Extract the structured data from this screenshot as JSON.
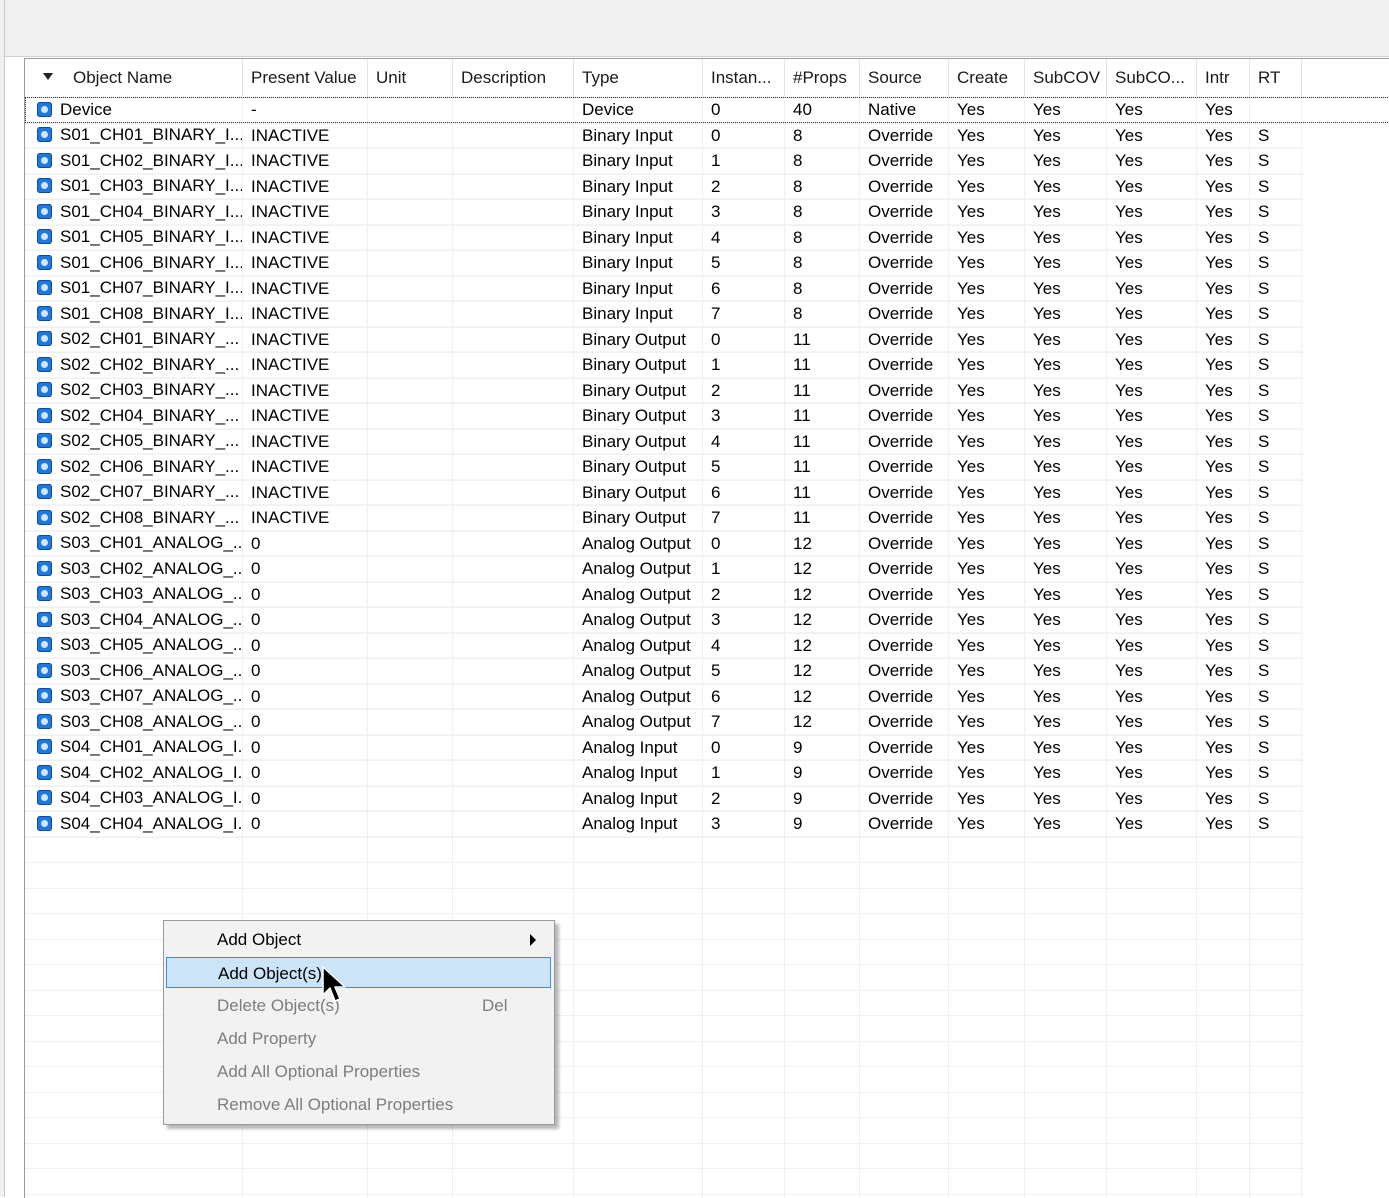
{
  "columns": [
    {
      "key": "name",
      "label": "Object Name"
    },
    {
      "key": "pv",
      "label": "Present Value"
    },
    {
      "key": "unit",
      "label": "Unit"
    },
    {
      "key": "desc",
      "label": "Description"
    },
    {
      "key": "type",
      "label": "Type"
    },
    {
      "key": "inst",
      "label": "Instan..."
    },
    {
      "key": "props",
      "label": "#Props"
    },
    {
      "key": "source",
      "label": "Source"
    },
    {
      "key": "create",
      "label": "Create"
    },
    {
      "key": "subcov",
      "label": "SubCOV"
    },
    {
      "key": "subco",
      "label": "SubCO..."
    },
    {
      "key": "intr",
      "label": "Intr"
    },
    {
      "key": "rt",
      "label": "RT"
    }
  ],
  "rows": [
    {
      "name": "Device",
      "pv": "-",
      "unit": "",
      "desc": "",
      "type": "Device",
      "inst": "0",
      "props": "40",
      "source": "Native",
      "create": "Yes",
      "subcov": "Yes",
      "subco": "Yes",
      "intr": "Yes",
      "rt": ""
    },
    {
      "name": "S01_CH01_BINARY_I...",
      "pv": "INACTIVE",
      "unit": "",
      "desc": "",
      "type": "Binary Input",
      "inst": "0",
      "props": "8",
      "source": "Override",
      "create": "Yes",
      "subcov": "Yes",
      "subco": "Yes",
      "intr": "Yes",
      "rt": "S"
    },
    {
      "name": "S01_CH02_BINARY_I...",
      "pv": "INACTIVE",
      "unit": "",
      "desc": "",
      "type": "Binary Input",
      "inst": "1",
      "props": "8",
      "source": "Override",
      "create": "Yes",
      "subcov": "Yes",
      "subco": "Yes",
      "intr": "Yes",
      "rt": "S"
    },
    {
      "name": "S01_CH03_BINARY_I...",
      "pv": "INACTIVE",
      "unit": "",
      "desc": "",
      "type": "Binary Input",
      "inst": "2",
      "props": "8",
      "source": "Override",
      "create": "Yes",
      "subcov": "Yes",
      "subco": "Yes",
      "intr": "Yes",
      "rt": "S"
    },
    {
      "name": "S01_CH04_BINARY_I...",
      "pv": "INACTIVE",
      "unit": "",
      "desc": "",
      "type": "Binary Input",
      "inst": "3",
      "props": "8",
      "source": "Override",
      "create": "Yes",
      "subcov": "Yes",
      "subco": "Yes",
      "intr": "Yes",
      "rt": "S"
    },
    {
      "name": "S01_CH05_BINARY_I...",
      "pv": "INACTIVE",
      "unit": "",
      "desc": "",
      "type": "Binary Input",
      "inst": "4",
      "props": "8",
      "source": "Override",
      "create": "Yes",
      "subcov": "Yes",
      "subco": "Yes",
      "intr": "Yes",
      "rt": "S"
    },
    {
      "name": "S01_CH06_BINARY_I...",
      "pv": "INACTIVE",
      "unit": "",
      "desc": "",
      "type": "Binary Input",
      "inst": "5",
      "props": "8",
      "source": "Override",
      "create": "Yes",
      "subcov": "Yes",
      "subco": "Yes",
      "intr": "Yes",
      "rt": "S"
    },
    {
      "name": "S01_CH07_BINARY_I...",
      "pv": "INACTIVE",
      "unit": "",
      "desc": "",
      "type": "Binary Input",
      "inst": "6",
      "props": "8",
      "source": "Override",
      "create": "Yes",
      "subcov": "Yes",
      "subco": "Yes",
      "intr": "Yes",
      "rt": "S"
    },
    {
      "name": "S01_CH08_BINARY_I...",
      "pv": "INACTIVE",
      "unit": "",
      "desc": "",
      "type": "Binary Input",
      "inst": "7",
      "props": "8",
      "source": "Override",
      "create": "Yes",
      "subcov": "Yes",
      "subco": "Yes",
      "intr": "Yes",
      "rt": "S"
    },
    {
      "name": "S02_CH01_BINARY_...",
      "pv": "INACTIVE",
      "unit": "",
      "desc": "",
      "type": "Binary Output",
      "inst": "0",
      "props": "11",
      "source": "Override",
      "create": "Yes",
      "subcov": "Yes",
      "subco": "Yes",
      "intr": "Yes",
      "rt": "S"
    },
    {
      "name": "S02_CH02_BINARY_...",
      "pv": "INACTIVE",
      "unit": "",
      "desc": "",
      "type": "Binary Output",
      "inst": "1",
      "props": "11",
      "source": "Override",
      "create": "Yes",
      "subcov": "Yes",
      "subco": "Yes",
      "intr": "Yes",
      "rt": "S"
    },
    {
      "name": "S02_CH03_BINARY_...",
      "pv": "INACTIVE",
      "unit": "",
      "desc": "",
      "type": "Binary Output",
      "inst": "2",
      "props": "11",
      "source": "Override",
      "create": "Yes",
      "subcov": "Yes",
      "subco": "Yes",
      "intr": "Yes",
      "rt": "S"
    },
    {
      "name": "S02_CH04_BINARY_...",
      "pv": "INACTIVE",
      "unit": "",
      "desc": "",
      "type": "Binary Output",
      "inst": "3",
      "props": "11",
      "source": "Override",
      "create": "Yes",
      "subcov": "Yes",
      "subco": "Yes",
      "intr": "Yes",
      "rt": "S"
    },
    {
      "name": "S02_CH05_BINARY_...",
      "pv": "INACTIVE",
      "unit": "",
      "desc": "",
      "type": "Binary Output",
      "inst": "4",
      "props": "11",
      "source": "Override",
      "create": "Yes",
      "subcov": "Yes",
      "subco": "Yes",
      "intr": "Yes",
      "rt": "S"
    },
    {
      "name": "S02_CH06_BINARY_...",
      "pv": "INACTIVE",
      "unit": "",
      "desc": "",
      "type": "Binary Output",
      "inst": "5",
      "props": "11",
      "source": "Override",
      "create": "Yes",
      "subcov": "Yes",
      "subco": "Yes",
      "intr": "Yes",
      "rt": "S"
    },
    {
      "name": "S02_CH07_BINARY_...",
      "pv": "INACTIVE",
      "unit": "",
      "desc": "",
      "type": "Binary Output",
      "inst": "6",
      "props": "11",
      "source": "Override",
      "create": "Yes",
      "subcov": "Yes",
      "subco": "Yes",
      "intr": "Yes",
      "rt": "S"
    },
    {
      "name": "S02_CH08_BINARY_...",
      "pv": "INACTIVE",
      "unit": "",
      "desc": "",
      "type": "Binary Output",
      "inst": "7",
      "props": "11",
      "source": "Override",
      "create": "Yes",
      "subcov": "Yes",
      "subco": "Yes",
      "intr": "Yes",
      "rt": "S"
    },
    {
      "name": "S03_CH01_ANALOG_...",
      "pv": "0",
      "unit": "",
      "desc": "",
      "type": "Analog Output",
      "inst": "0",
      "props": "12",
      "source": "Override",
      "create": "Yes",
      "subcov": "Yes",
      "subco": "Yes",
      "intr": "Yes",
      "rt": "S"
    },
    {
      "name": "S03_CH02_ANALOG_...",
      "pv": "0",
      "unit": "",
      "desc": "",
      "type": "Analog Output",
      "inst": "1",
      "props": "12",
      "source": "Override",
      "create": "Yes",
      "subcov": "Yes",
      "subco": "Yes",
      "intr": "Yes",
      "rt": "S"
    },
    {
      "name": "S03_CH03_ANALOG_...",
      "pv": "0",
      "unit": "",
      "desc": "",
      "type": "Analog Output",
      "inst": "2",
      "props": "12",
      "source": "Override",
      "create": "Yes",
      "subcov": "Yes",
      "subco": "Yes",
      "intr": "Yes",
      "rt": "S"
    },
    {
      "name": "S03_CH04_ANALOG_...",
      "pv": "0",
      "unit": "",
      "desc": "",
      "type": "Analog Output",
      "inst": "3",
      "props": "12",
      "source": "Override",
      "create": "Yes",
      "subcov": "Yes",
      "subco": "Yes",
      "intr": "Yes",
      "rt": "S"
    },
    {
      "name": "S03_CH05_ANALOG_...",
      "pv": "0",
      "unit": "",
      "desc": "",
      "type": "Analog Output",
      "inst": "4",
      "props": "12",
      "source": "Override",
      "create": "Yes",
      "subcov": "Yes",
      "subco": "Yes",
      "intr": "Yes",
      "rt": "S"
    },
    {
      "name": "S03_CH06_ANALOG_...",
      "pv": "0",
      "unit": "",
      "desc": "",
      "type": "Analog Output",
      "inst": "5",
      "props": "12",
      "source": "Override",
      "create": "Yes",
      "subcov": "Yes",
      "subco": "Yes",
      "intr": "Yes",
      "rt": "S"
    },
    {
      "name": "S03_CH07_ANALOG_...",
      "pv": "0",
      "unit": "",
      "desc": "",
      "type": "Analog Output",
      "inst": "6",
      "props": "12",
      "source": "Override",
      "create": "Yes",
      "subcov": "Yes",
      "subco": "Yes",
      "intr": "Yes",
      "rt": "S"
    },
    {
      "name": "S03_CH08_ANALOG_...",
      "pv": "0",
      "unit": "",
      "desc": "",
      "type": "Analog Output",
      "inst": "7",
      "props": "12",
      "source": "Override",
      "create": "Yes",
      "subcov": "Yes",
      "subco": "Yes",
      "intr": "Yes",
      "rt": "S"
    },
    {
      "name": "S04_CH01_ANALOG_I...",
      "pv": "0",
      "unit": "",
      "desc": "",
      "type": "Analog Input",
      "inst": "0",
      "props": "9",
      "source": "Override",
      "create": "Yes",
      "subcov": "Yes",
      "subco": "Yes",
      "intr": "Yes",
      "rt": "S"
    },
    {
      "name": "S04_CH02_ANALOG_I...",
      "pv": "0",
      "unit": "",
      "desc": "",
      "type": "Analog Input",
      "inst": "1",
      "props": "9",
      "source": "Override",
      "create": "Yes",
      "subcov": "Yes",
      "subco": "Yes",
      "intr": "Yes",
      "rt": "S"
    },
    {
      "name": "S04_CH03_ANALOG_I...",
      "pv": "0",
      "unit": "",
      "desc": "",
      "type": "Analog Input",
      "inst": "2",
      "props": "9",
      "source": "Override",
      "create": "Yes",
      "subcov": "Yes",
      "subco": "Yes",
      "intr": "Yes",
      "rt": "S"
    },
    {
      "name": "S04_CH04_ANALOG_I...",
      "pv": "0",
      "unit": "",
      "desc": "",
      "type": "Analog Input",
      "inst": "3",
      "props": "9",
      "source": "Override",
      "create": "Yes",
      "subcov": "Yes",
      "subco": "Yes",
      "intr": "Yes",
      "rt": "S"
    }
  ],
  "context_menu": {
    "add_object": "Add Object",
    "add_objects": "Add Object(s)...",
    "delete_objects": "Delete Object(s)",
    "delete_shortcut": "Del",
    "add_property": "Add Property",
    "add_all_optional": "Add All Optional Properties",
    "remove_all_optional": "Remove All Optional Properties"
  },
  "colors": {
    "object_icon": "#1f78e0",
    "menu_highlight": "#cce4f7",
    "menu_highlight_border": "#3d8ee0",
    "disabled_text": "#7d7d7d"
  }
}
